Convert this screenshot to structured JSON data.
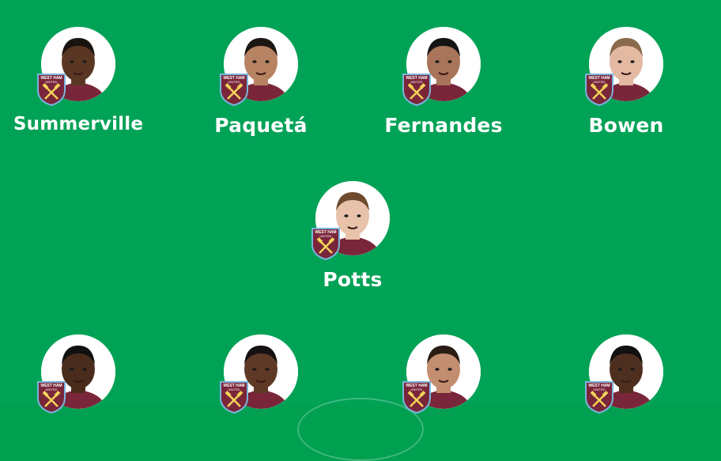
{
  "formation": {
    "rows": [
      {
        "players": [
          {
            "name": "Summerville",
            "club_badge": "west-ham-united-badge",
            "skin": "#5a3722",
            "hair": "#1a1410"
          },
          {
            "name": "Paquetá",
            "club_badge": "west-ham-united-badge",
            "skin": "#b78363",
            "hair": "#1e1612"
          },
          {
            "name": "Fernandes",
            "club_badge": "west-ham-united-badge",
            "skin": "#a8745a",
            "hair": "#141414"
          },
          {
            "name": "Bowen",
            "club_badge": "west-ham-united-badge",
            "skin": "#e3b9a2",
            "hair": "#8a6a4c"
          }
        ]
      },
      {
        "players": [
          {
            "name": "Potts",
            "club_badge": "west-ham-united-badge",
            "skin": "#e8c2aa",
            "hair": "#6e4b2e"
          }
        ]
      },
      {
        "players": [
          {
            "name": "",
            "club_badge": "west-ham-united-badge",
            "skin": "#4a2c1c",
            "hair": "#111111"
          },
          {
            "name": "",
            "club_badge": "west-ham-united-badge",
            "skin": "#5e3a26",
            "hair": "#161111"
          },
          {
            "name": "",
            "club_badge": "west-ham-united-badge",
            "skin": "#c38e70",
            "hair": "#2a1c14"
          },
          {
            "name": "",
            "club_badge": "west-ham-united-badge",
            "skin": "#4e2f1f",
            "hair": "#121010"
          }
        ]
      }
    ]
  },
  "badge_text": {
    "line1": "WEST HAM",
    "line2": "UNITED"
  },
  "colors": {
    "pitch": "#00a256",
    "badge_claret": "#7a263a",
    "badge_blue": "#7bb5dd",
    "badge_gold": "#f3d459",
    "name_text": "#ffffff"
  }
}
